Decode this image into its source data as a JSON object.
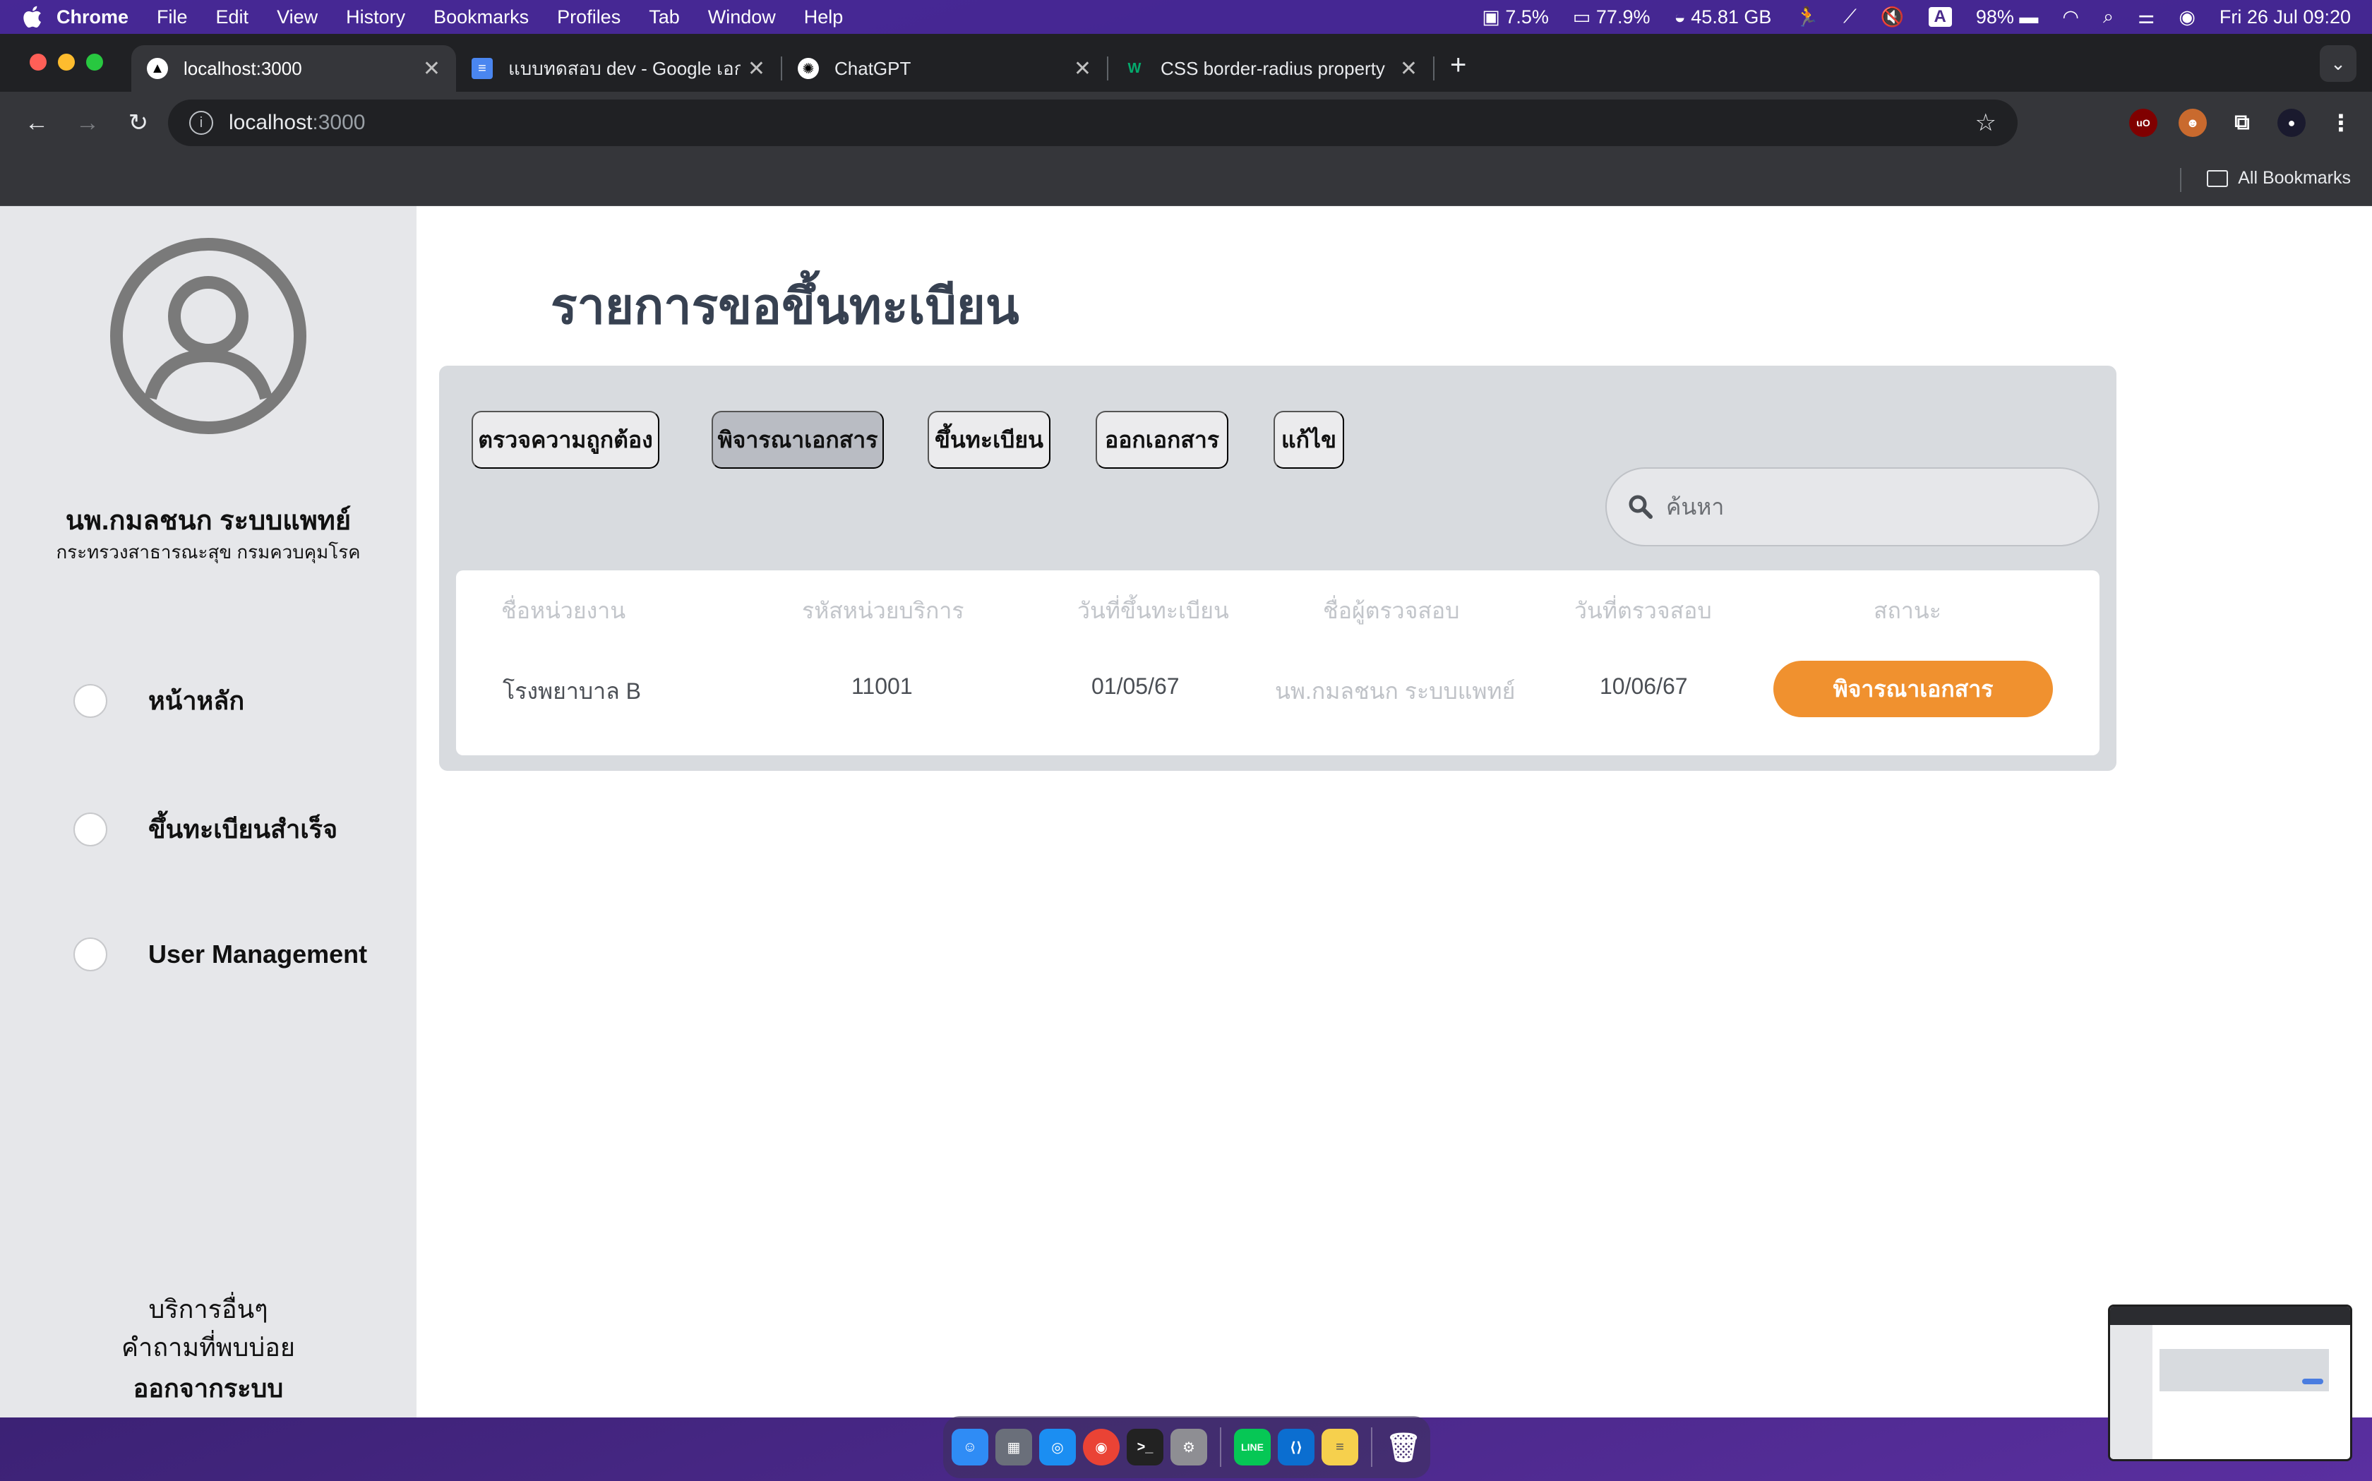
{
  "menubar": {
    "app": "Chrome",
    "items": [
      "File",
      "Edit",
      "View",
      "History",
      "Bookmarks",
      "Profiles",
      "Tab",
      "Window",
      "Help"
    ],
    "cpu": "7.5%",
    "battery_widget": "77.9%",
    "disk": "45.81 GB",
    "input_source": "A",
    "battery": "98%",
    "datetime": "Fri 26 Jul  09:20"
  },
  "browser": {
    "tabs": [
      {
        "title": "localhost:3000",
        "icon": "nextjs-favicon-icon",
        "active": true
      },
      {
        "title": "แบบทดสอบ dev - Google เอกสาร",
        "icon": "google-docs-icon",
        "active": false
      },
      {
        "title": "ChatGPT",
        "icon": "chatgpt-icon",
        "active": false
      },
      {
        "title": "CSS border-radius property",
        "icon": "w3schools-icon",
        "active": false
      }
    ],
    "url_host": "localhost",
    "url_port": ":3000",
    "all_bookmarks": "All Bookmarks"
  },
  "sidebar": {
    "user_name": "นพ.กมลชนก ระบบแพทย์",
    "user_org": "กระทรวงสาธารณะสุข กรมควบคุมโรค",
    "nav": [
      {
        "label": "หน้าหลัก"
      },
      {
        "label": "ขึ้นทะเบียนสำเร็จ"
      },
      {
        "label": "User Management"
      }
    ],
    "other_services": "บริการอื่นๆ",
    "faq": "คำถามที่พบบ่อย",
    "logout": "ออกจากระบบ"
  },
  "main": {
    "title": "รายการขอขึ้นทะเบียน",
    "filter_tabs": [
      {
        "label": "ตรวจความถูกต้อง",
        "active": false
      },
      {
        "label": "พิจารณาเอกสาร",
        "active": true
      },
      {
        "label": "ขึ้นทะเบียน",
        "active": false
      },
      {
        "label": "ออกเอกสาร",
        "active": false
      },
      {
        "label": "แก้ไข",
        "active": false
      }
    ],
    "search_placeholder": "ค้นหา",
    "table": {
      "columns": [
        "ชื่อหน่วยงาน",
        "รหัสหน่วยบริการ",
        "วันที่ขึ้นทะเบียน",
        "ชื่อผู้ตรวจสอบ",
        "วันที่ตรวจสอบ",
        "สถานะ"
      ],
      "rows": [
        {
          "agency": "โรงพยาบาล B",
          "service_code": "11001",
          "registered_date": "01/05/67",
          "inspector": "นพ.กมลชนก ระบบแพทย์",
          "inspected_date": "10/06/67",
          "status": "พิจารณาเอกสาร"
        }
      ]
    }
  },
  "colors": {
    "status_orange": "#f0912f",
    "sidebar_bg": "#e6e7ea",
    "panel_bg": "#d8dbdf"
  }
}
